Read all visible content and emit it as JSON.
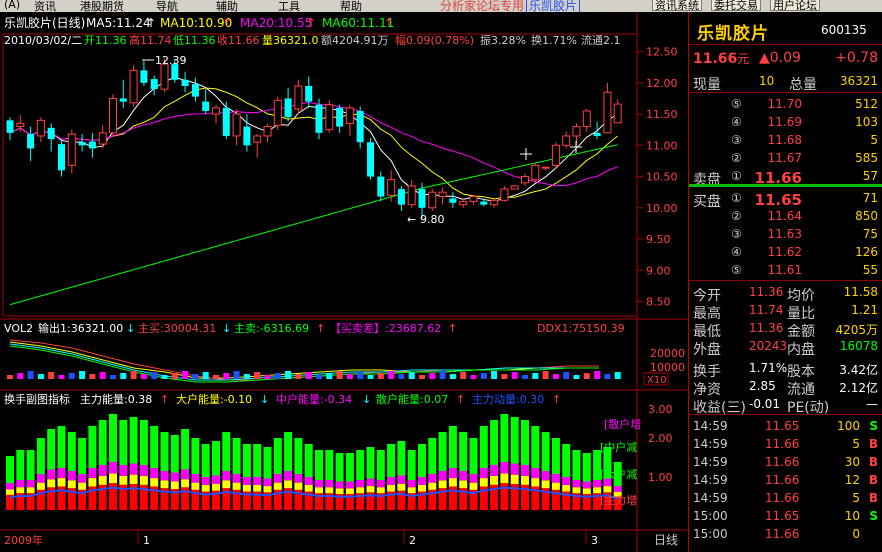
{
  "menu": [
    "资讯",
    "港股期货",
    "导航",
    "辅助",
    "工具",
    "帮助"
  ],
  "menu_letter": "A",
  "forum": {
    "text": "分析家论坛专用",
    "stock": "乐凯胶片"
  },
  "buttons": [
    "资讯系统",
    "委托交易",
    "用户论坛"
  ],
  "chart": {
    "title": "乐凯胶片(日线)",
    "ma5": "MA5:11.24",
    "ma10": "MA10:10.90",
    "ma20": "MA20:10.55",
    "ma60": "MA60:11.11",
    "info_date": "2010/03/02/二",
    "info_open": "开11.36",
    "info_high": "高11.74",
    "info_low": "低11.36",
    "info_close": "收11.66",
    "info_vol": "量36321.0",
    "info_amt": "额4204.91万",
    "info_fu": "幅0.09(0.78%)",
    "info_zhen": "振3.28%",
    "info_huan": "换1.71%",
    "info_liu": "流通2.1",
    "high_mark": "12.39",
    "low_mark": "9.80",
    "price_axis": [
      "12.50",
      "12.00",
      "11.50",
      "11.00",
      "10.50",
      "10.00",
      "9.50",
      "9.00",
      "8.50"
    ],
    "vol_title": "VOL2",
    "vol_out": "输出1:36321.00",
    "vol_zm": "主买:30004.31",
    "vol_zs": "主卖:-6316.69",
    "vol_mmc": "【买卖差】:23687.62",
    "vol_ddx": "DDX1:75150.39",
    "vol_axis": [
      "20000",
      "10000"
    ],
    "vol_x10": "X10",
    "ind_title": "换手副图指标",
    "ind_zl": "主力能量:0.38",
    "ind_dh": "大户能量:-0.10",
    "ind_zh": "中户能量:-0.34",
    "ind_sh": "散户能量:0.07",
    "ind_zd": "主力动量:0.30",
    "ind_axis": [
      "3.00",
      "2.00",
      "1.00"
    ],
    "ind_labels": [
      "散户增",
      "中户减",
      "大户减",
      "主力增"
    ],
    "xaxis": {
      "year": "2009年",
      "m1": "1",
      "m2": "2",
      "m3": "3",
      "period": "日线"
    }
  },
  "chart_data": {
    "type": "candlestick",
    "y_range": [
      8.3,
      12.75
    ],
    "ohlc": [
      [
        11.4,
        11.45,
        11.08,
        11.2
      ],
      [
        11.3,
        11.48,
        11.22,
        11.35
      ],
      [
        11.18,
        11.3,
        10.75,
        10.95
      ],
      [
        11.15,
        11.45,
        11.05,
        11.4
      ],
      [
        11.28,
        11.35,
        10.9,
        11.1
      ],
      [
        11.02,
        11.1,
        10.5,
        10.6
      ],
      [
        10.68,
        11.25,
        10.55,
        11.18
      ],
      [
        11.05,
        11.18,
        10.9,
        11.0
      ],
      [
        11.06,
        11.2,
        10.8,
        10.95
      ],
      [
        11.02,
        11.32,
        10.95,
        11.2
      ],
      [
        11.2,
        11.82,
        11.15,
        11.75
      ],
      [
        11.75,
        12.05,
        11.6,
        11.7
      ],
      [
        11.68,
        12.28,
        11.62,
        12.2
      ],
      [
        12.2,
        12.35,
        11.95,
        12.0
      ],
      [
        12.06,
        12.12,
        11.8,
        11.9
      ],
      [
        11.9,
        12.39,
        11.85,
        12.3
      ],
      [
        12.3,
        12.38,
        12.0,
        12.05
      ],
      [
        12.05,
        12.18,
        11.85,
        11.95
      ],
      [
        11.98,
        12.08,
        11.7,
        11.78
      ],
      [
        11.7,
        11.9,
        11.5,
        11.55
      ],
      [
        11.5,
        11.65,
        11.35,
        11.6
      ],
      [
        11.6,
        11.7,
        11.1,
        11.15
      ],
      [
        11.15,
        11.58,
        11.0,
        11.5
      ],
      [
        11.3,
        11.5,
        10.9,
        11.0
      ],
      [
        11.05,
        11.18,
        10.8,
        11.15
      ],
      [
        11.15,
        11.35,
        11.05,
        11.3
      ],
      [
        11.32,
        11.78,
        11.25,
        11.72
      ],
      [
        11.75,
        11.92,
        11.38,
        11.45
      ],
      [
        11.58,
        12.05,
        11.5,
        11.95
      ],
      [
        11.95,
        12.1,
        11.6,
        11.7
      ],
      [
        11.65,
        11.75,
        11.1,
        11.2
      ],
      [
        11.25,
        11.72,
        11.2,
        11.65
      ],
      [
        11.6,
        11.65,
        11.2,
        11.3
      ],
      [
        11.35,
        11.65,
        11.15,
        11.6
      ],
      [
        11.55,
        11.62,
        10.95,
        11.05
      ],
      [
        11.05,
        11.12,
        10.45,
        10.5
      ],
      [
        10.5,
        10.58,
        10.1,
        10.18
      ],
      [
        10.2,
        10.6,
        10.1,
        10.45
      ],
      [
        10.3,
        10.35,
        9.95,
        10.05
      ],
      [
        10.05,
        10.45,
        10.0,
        10.35
      ],
      [
        10.3,
        10.4,
        9.8,
        10.0
      ],
      [
        10.0,
        10.3,
        9.95,
        10.25
      ],
      [
        10.18,
        10.32,
        10.05,
        10.25
      ],
      [
        10.15,
        10.25,
        10.0,
        10.08
      ],
      [
        10.05,
        10.15,
        10.0,
        10.1
      ],
      [
        10.1,
        10.2,
        10.05,
        10.18
      ],
      [
        10.1,
        10.15,
        10.02,
        10.05
      ],
      [
        10.05,
        10.15,
        10.0,
        10.12
      ],
      [
        10.12,
        10.35,
        10.1,
        10.3
      ],
      [
        10.3,
        10.36,
        10.3,
        10.35
      ],
      [
        10.4,
        10.55,
        10.35,
        10.5
      ],
      [
        10.45,
        10.72,
        10.4,
        10.68
      ],
      [
        10.65,
        10.66,
        10.6,
        10.65
      ],
      [
        10.68,
        11.05,
        10.62,
        11.0
      ],
      [
        11.0,
        11.22,
        10.95,
        11.15
      ],
      [
        11.15,
        11.35,
        11.0,
        11.3
      ],
      [
        11.3,
        11.58,
        11.22,
        11.55
      ],
      [
        11.2,
        11.38,
        11.1,
        11.15
      ],
      [
        11.2,
        12.0,
        11.2,
        11.85
      ],
      [
        11.36,
        11.74,
        11.36,
        11.66
      ]
    ],
    "ma_series": [
      {
        "name": "MA5",
        "color": "#ffffff"
      },
      {
        "name": "MA10",
        "color": "#ffff00"
      },
      {
        "name": "MA20",
        "color": "#ff00ff"
      },
      {
        "name": "MA60",
        "color": "#00ff00"
      }
    ],
    "energy": [
      0.9,
      1.0,
      1.0,
      1.2,
      1.35,
      1.4,
      1.3,
      1.2,
      1.4,
      1.5,
      1.6,
      1.5,
      1.55,
      1.5,
      1.4,
      1.3,
      1.25,
      1.35,
      1.2,
      1.1,
      1.15,
      1.3,
      1.2,
      1.1,
      1.1,
      1.05,
      1.2,
      1.3,
      1.2,
      1.1,
      1.0,
      1.0,
      0.95,
      0.95,
      1.0,
      1.05,
      1.0,
      1.1,
      1.15,
      1.0,
      1.1,
      1.2,
      1.3,
      1.4,
      1.3,
      1.2,
      1.4,
      1.5,
      1.6,
      1.55,
      1.5,
      1.4,
      1.3,
      1.2,
      1.1,
      1.0,
      0.95,
      1.0,
      1.05,
      0.8
    ]
  },
  "quote": {
    "name": "乐凯胶片",
    "code": "600135",
    "price": "11.66",
    "unit": "元",
    "change": "▲0.09",
    "pct": "+0.78",
    "xianliang_label": "现量",
    "xianliang": "10",
    "zongliang_label": "总量",
    "zongliang": "36321",
    "sell_label": "卖盘",
    "buy_label": "买盘",
    "sell": [
      {
        "lvl": "⑤",
        "price": "11.70",
        "vol": "512"
      },
      {
        "lvl": "④",
        "price": "11.69",
        "vol": "103"
      },
      {
        "lvl": "③",
        "price": "11.68",
        "vol": "5"
      },
      {
        "lvl": "②",
        "price": "11.67",
        "vol": "585"
      },
      {
        "lvl": "①",
        "price": "11.66",
        "vol": "57"
      }
    ],
    "buy": [
      {
        "lvl": "①",
        "price": "11.65",
        "vol": "71"
      },
      {
        "lvl": "②",
        "price": "11.64",
        "vol": "850"
      },
      {
        "lvl": "③",
        "price": "11.63",
        "vol": "75"
      },
      {
        "lvl": "④",
        "price": "11.62",
        "vol": "126"
      },
      {
        "lvl": "⑤",
        "price": "11.61",
        "vol": "55"
      }
    ],
    "stats": [
      [
        {
          "l": "今开",
          "v": "11.36"
        },
        {
          "l": "均价",
          "v": "11.58"
        }
      ],
      [
        {
          "l": "最高",
          "v": "11.74"
        },
        {
          "l": "量比",
          "v": "1.21"
        }
      ],
      [
        {
          "l": "最低",
          "v": "11.36"
        },
        {
          "l": "金额",
          "v": "4205万"
        }
      ],
      [
        {
          "l": "外盘",
          "v": "20243"
        },
        {
          "l": "内盘",
          "v": "16078"
        }
      ],
      [
        {
          "l": "换手",
          "v": "1.71%"
        },
        {
          "l": "股本",
          "v": "3.42亿"
        }
      ],
      [
        {
          "l": "净资",
          "v": "2.85"
        },
        {
          "l": "流通",
          "v": "2.12亿"
        }
      ],
      [
        {
          "l": "收益(三)",
          "v": "-0.01"
        },
        {
          "l": "PE(动)",
          "v": "—"
        }
      ]
    ],
    "ticks": [
      {
        "t": "14:59",
        "p": "11.65",
        "v": "100",
        "s": "S"
      },
      {
        "t": "14:59",
        "p": "11.66",
        "v": "5",
        "s": "B"
      },
      {
        "t": "14:59",
        "p": "11.66",
        "v": "30",
        "s": "B"
      },
      {
        "t": "14:59",
        "p": "11.66",
        "v": "12",
        "s": "B"
      },
      {
        "t": "14:59",
        "p": "11.66",
        "v": "5",
        "s": "B"
      },
      {
        "t": "15:00",
        "p": "11.65",
        "v": "10",
        "s": "S"
      },
      {
        "t": "15:00",
        "p": "11.66",
        "v": "0",
        "s": ""
      }
    ]
  }
}
